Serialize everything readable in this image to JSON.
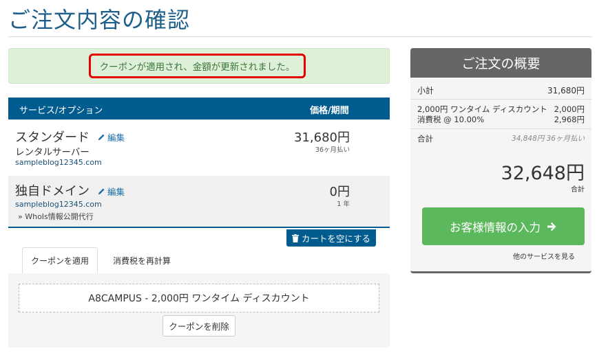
{
  "page": {
    "title": "ご注文内容の確認"
  },
  "alert": {
    "message": "クーポンが適用され、金額が更新されました。"
  },
  "cart": {
    "header": {
      "service": "サービス/オプション",
      "price": "価格/期間"
    },
    "items": [
      {
        "name": "スタンダード",
        "edit": "編集",
        "group": "レンタルサーバー",
        "domain": "sampleblog12345.com",
        "price": "31,680円",
        "cycle": "36ヶ月払い"
      },
      {
        "name": "独自ドメイン",
        "edit": "編集",
        "domain": "sampleblog12345.com",
        "addon": "» WhoIs情報公開代行",
        "price": "0円",
        "cycle": "1 年"
      }
    ],
    "empty_cart": "カートを空にする"
  },
  "tabs": [
    {
      "label": "クーポンを適用"
    },
    {
      "label": "消費税を再計算"
    }
  ],
  "coupon": {
    "applied": "A8CAMPUS - 2,000円 ワンタイム ディスカウント",
    "remove": "クーポンを削除"
  },
  "summary": {
    "title": "ご注文の概要",
    "subtotal_label": "小計",
    "subtotal_value": "31,680円",
    "discount_label": "2,000円 ワンタイム ディスカウント",
    "discount_value": "2,000円",
    "tax_label": "消費税 @ 10.00%",
    "tax_value": "2,968円",
    "total_label": "合計",
    "total_note": "34,848円 36ヶ月払い",
    "total": "32,648円",
    "total_caption": "合計",
    "checkout": "お客様情報の入力",
    "other_services": "他のサービスを見る"
  },
  "colors": {
    "brand_blue": "#005c8f",
    "success_green": "#5cb85c",
    "alert_bg": "#dff0d8",
    "highlight_red": "#e60000"
  }
}
